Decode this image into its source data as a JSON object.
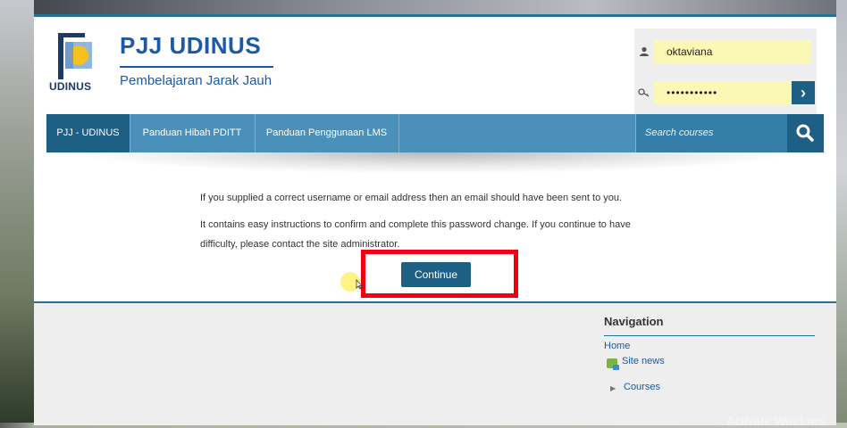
{
  "header": {
    "site_title": "PJJ UDINUS",
    "site_subtitle": "Pembelajaran Jarak Jauh",
    "logo_text": "UDINUS"
  },
  "login": {
    "username_value": "oktaviana",
    "password_value": "•••••••••••",
    "go_label": "›"
  },
  "nav": {
    "items": [
      {
        "label": "PJJ - UDINUS",
        "active": true
      },
      {
        "label": "Panduan Hibah PDITT",
        "active": false
      },
      {
        "label": "Panduan Penggunaan LMS",
        "active": false
      }
    ],
    "search_placeholder": "Search courses"
  },
  "main": {
    "message_1": "If you supplied a correct username or email address then an email should have been sent to you.",
    "message_2": "It contains easy instructions to confirm and complete this password change. If you continue to have difficulty, please contact the site administrator.",
    "continue_label": "Continue"
  },
  "navigation_block": {
    "title": "Navigation",
    "home": "Home",
    "site_news": "Site news",
    "courses": "Courses"
  },
  "overlay": {
    "watermark": "Activate Windows"
  },
  "colors": {
    "brand": "#1c5aa6",
    "nav": "#4a90b9",
    "nav_active": "#1e5f86",
    "highlight": "#ef0010"
  }
}
